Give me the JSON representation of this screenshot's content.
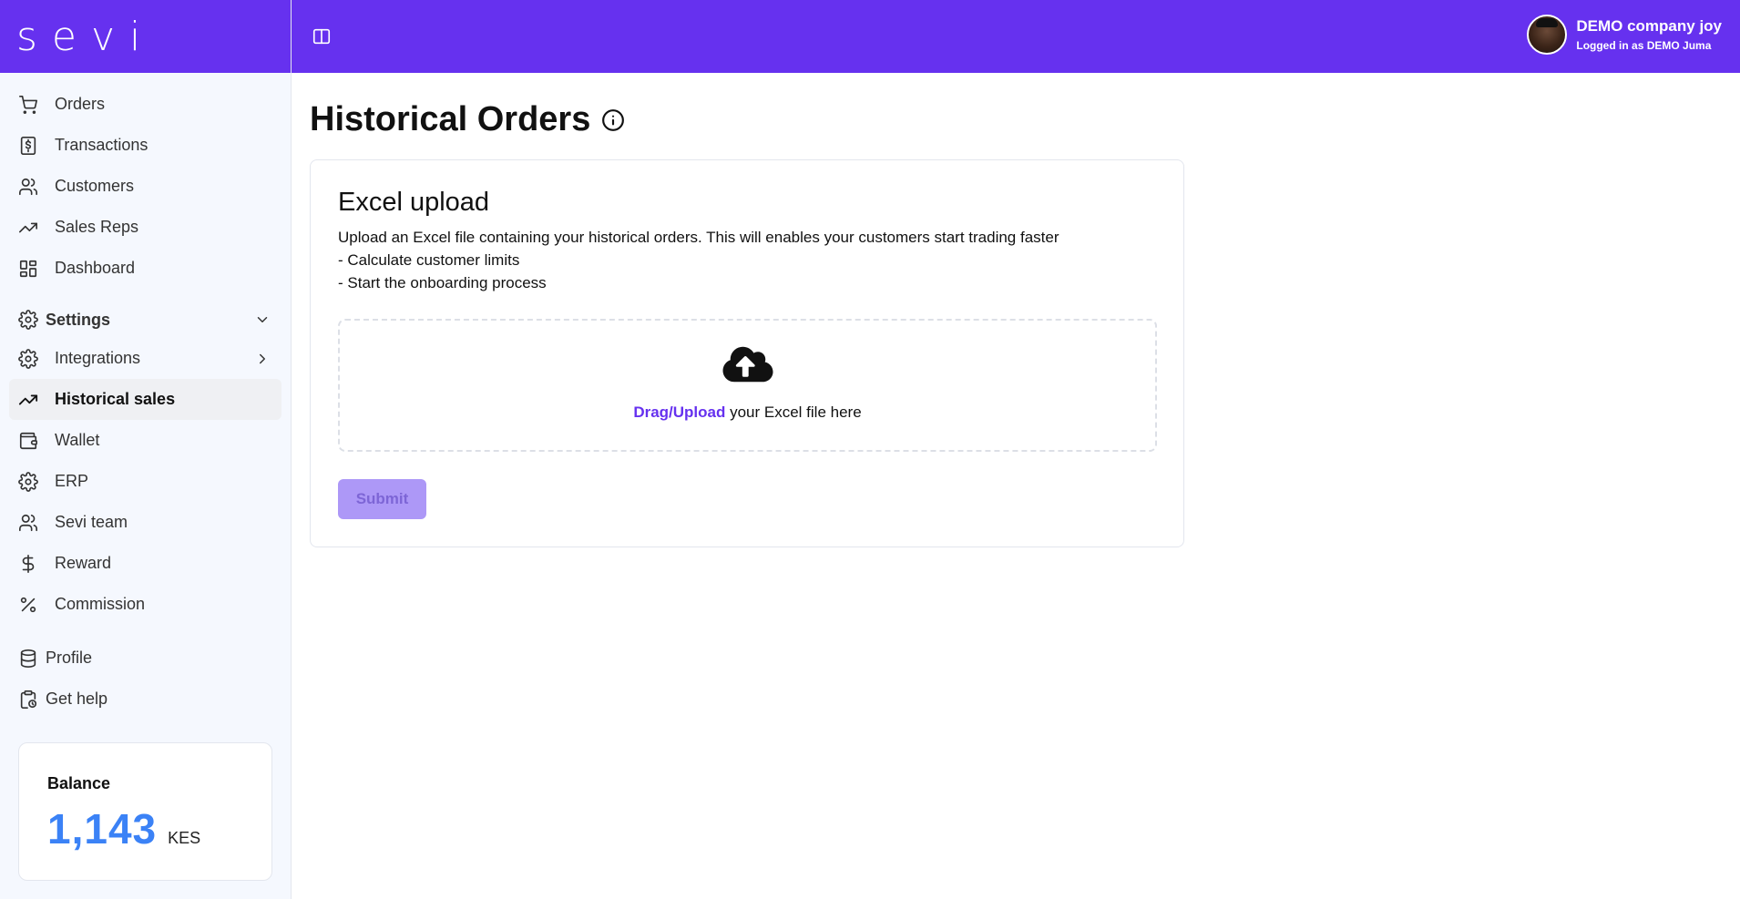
{
  "brand": {
    "logo": "sevi",
    "color": "#6631ef"
  },
  "sidebar": {
    "items": [
      {
        "label": "Orders",
        "icon": "cart-icon"
      },
      {
        "label": "Transactions",
        "icon": "dollar-receipt-icon"
      },
      {
        "label": "Customers",
        "icon": "users-icon"
      },
      {
        "label": "Sales Reps",
        "icon": "trending-up-icon"
      },
      {
        "label": "Dashboard",
        "icon": "dashboard-grid-icon"
      }
    ],
    "settings": {
      "label": "Settings",
      "items": [
        {
          "label": "Integrations",
          "icon": "gear-icon"
        },
        {
          "label": "Historical sales",
          "icon": "trending-up-icon",
          "active": true
        },
        {
          "label": "Wallet",
          "icon": "wallet-icon"
        },
        {
          "label": "ERP",
          "icon": "gear-icon"
        },
        {
          "label": "Sevi team",
          "icon": "users-icon"
        },
        {
          "label": "Reward",
          "icon": "dollar-icon"
        },
        {
          "label": "Commission",
          "icon": "percent-icon"
        }
      ]
    },
    "footer_items": [
      {
        "label": "Profile",
        "icon": "database-icon"
      },
      {
        "label": "Get help",
        "icon": "clipboard-icon"
      }
    ],
    "balance": {
      "label": "Balance",
      "value": "1,143",
      "currency": "KES",
      "value_color": "#3b82f6"
    }
  },
  "header": {
    "user_name": "DEMO company joy",
    "user_sub": "Logged in as DEMO Juma"
  },
  "main": {
    "title": "Historical Orders",
    "card": {
      "title": "Excel upload",
      "desc_line1": "Upload an Excel file containing your historical orders. This will enables your customers start trading faster",
      "desc_line2": "- Calculate customer limits",
      "desc_line3": "- Start the onboarding process",
      "drop_link": "Drag/Upload",
      "drop_text": " your Excel file here",
      "submit_label": "Submit"
    }
  }
}
